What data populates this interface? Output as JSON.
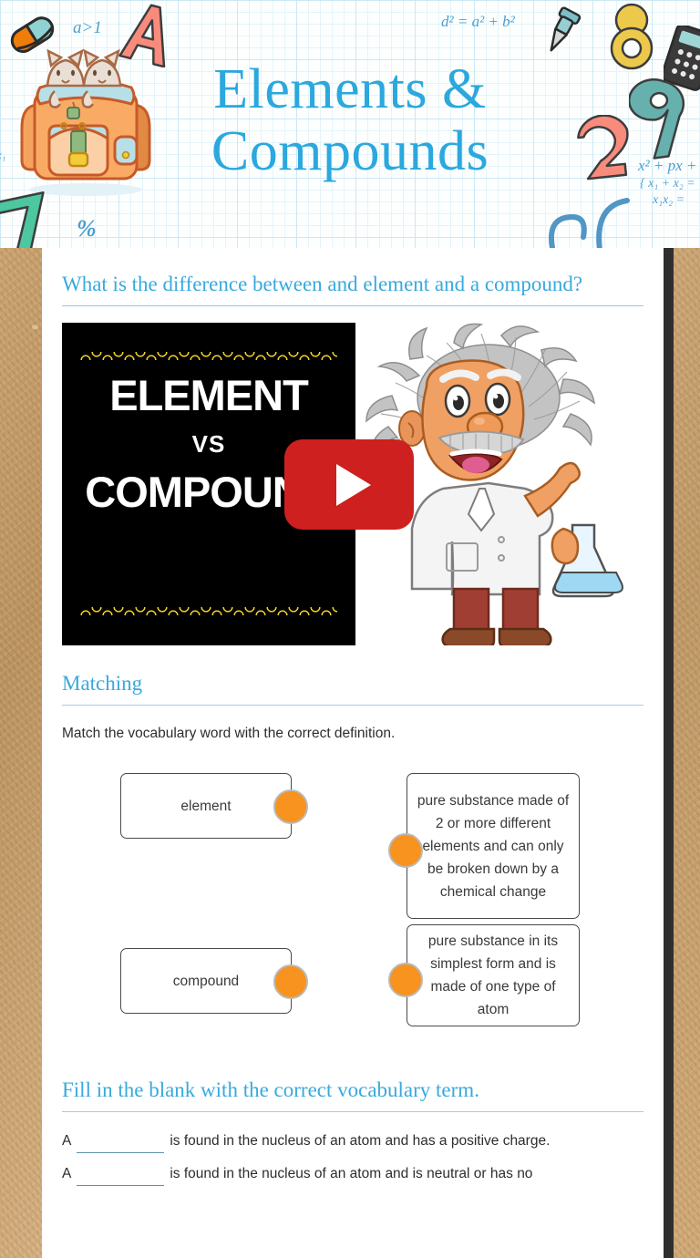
{
  "banner": {
    "title_line1": "Elements &",
    "title_line2": "Compounds",
    "title_color": "#2ba8dd",
    "doodles": [
      {
        "name": "inequality-doodle",
        "text": "a>1"
      },
      {
        "name": "letter-a-doodle",
        "text": "A"
      },
      {
        "name": "pythagoras-doodle",
        "text": "d² = a² + b²"
      },
      {
        "name": "digit-eight-doodle",
        "text": "8"
      },
      {
        "name": "digit-nine-doodle",
        "text": "9"
      },
      {
        "name": "digit-two-doodle",
        "text": "2"
      },
      {
        "name": "digit-seven-doodle",
        "text": "7"
      },
      {
        "name": "percent-doodle",
        "text": "%"
      },
      {
        "name": "quadratic-doodle",
        "text": "x² + px +"
      },
      {
        "name": "vieta-line1-doodle",
        "text": "{ x₁ + x₂ ="
      },
      {
        "name": "vieta-line2-doodle",
        "text": "x₁x₂ ="
      }
    ]
  },
  "question_section": {
    "heading": "What is the difference between and element and a compound?",
    "video": {
      "thumb_line1": "ELEMENT",
      "thumb_line2": "VS",
      "thumb_line3": "COMPOUND",
      "play_label": "play-video",
      "play_color": "#cd201f"
    }
  },
  "matching_section": {
    "heading": "Matching",
    "instructions": "Match the vocabulary word with the correct definition.",
    "dot_color": "#f7931e",
    "terms": [
      {
        "label": "element"
      },
      {
        "label": "compound"
      }
    ],
    "definitions": [
      {
        "label": "pure substance made of 2 or more different elements and can only be broken down by a chemical change"
      },
      {
        "label": "pure substance in its simplest form and is made of one type of atom"
      }
    ]
  },
  "fill_blank_section": {
    "heading": "Fill in the blank with the correct vocabulary term.",
    "items": [
      {
        "before": "A",
        "value": "",
        "after": "is found in the nucleus of an atom and has a positive charge."
      },
      {
        "before": "A",
        "value": "",
        "after": "is found in the nucleus of an atom and is neutral or has no"
      }
    ]
  }
}
